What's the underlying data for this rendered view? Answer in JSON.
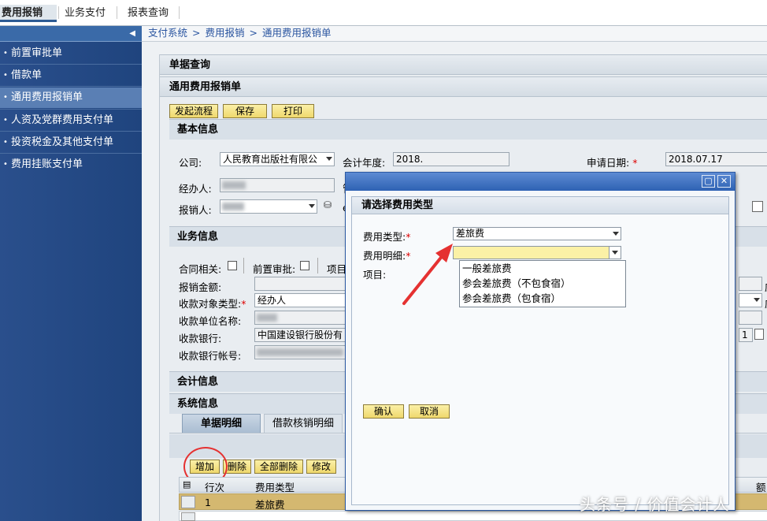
{
  "top_tabs": [
    "费用报销",
    "业务支付",
    "报表查询"
  ],
  "nav": {
    "collapse_icon": "triangle-left-icon",
    "items": [
      "前置审批单",
      "借款单",
      "通用费用报销单",
      "人资及党群费用支付单",
      "投资税金及其他支付单",
      "费用挂账支付单"
    ],
    "bullet": "•"
  },
  "breadcrumb": [
    "支付系统",
    ">",
    "费用报销",
    ">",
    "通用费用报销单"
  ],
  "panels": {
    "query": "单据查询",
    "form_title": "通用费用报销单"
  },
  "toolbar": {
    "submit": "发起流程",
    "save": "保存",
    "print": "打印"
  },
  "basic": {
    "title": "基本信息",
    "company_label": "公司:",
    "company_value": "人民教育出版社有限公",
    "fiscal_year_label": "会计年度:",
    "fiscal_year_value": "2018.",
    "apply_date_label": "申请日期:",
    "apply_date_value": "2018.07.17",
    "handler_label": "经办人:",
    "claimant_label": "报销人:",
    "cut_label_1": "管",
    "cut_label_2": "e"
  },
  "business": {
    "title": "业务信息",
    "contract_label": "合同相关:",
    "preapproval_label": "前置审批:",
    "project_label": "项目",
    "amount_label": "报销金额:",
    "payee_type_label": "收款对象类型:",
    "payee_type_value": "经办人",
    "payee_name_label": "收款单位名称:",
    "bank_label": "收款银行:",
    "bank_value": "中国建设银行股份有",
    "account_label": "收款银行帐号:",
    "cut_text": "应",
    "cut_num": "1"
  },
  "accounting": {
    "title": "会计信息"
  },
  "system": {
    "title": "系统信息"
  },
  "detail_tabs": [
    "单据明细",
    "借款核销明细"
  ],
  "detail_toolbar": {
    "add": "增加",
    "delete": "删除",
    "delete_all": "全部删除",
    "modify": "修改"
  },
  "table": {
    "headers": [
      "行次",
      "费用类型"
    ],
    "rows": [
      {
        "line": "1",
        "type": "差旅费"
      }
    ],
    "cut_header": "额"
  },
  "dialog": {
    "title": "请选择费用类型",
    "maximize_icon": "maximize-icon",
    "close_icon": "close-icon",
    "type_label": "费用类型:",
    "type_value": "差旅费",
    "detail_label": "费用明细:",
    "detail_value": "",
    "project_label": "项目:",
    "options": [
      "一般差旅费",
      "参会差旅费（不包食宿）",
      "参会差旅费（包食宿）"
    ],
    "confirm": "确认",
    "cancel": "取消",
    "required_mark": "*"
  },
  "watermark": "头条号 / 价值会计人",
  "colors": {
    "nav_bg": "#1f447e",
    "accent": "#2d5b93",
    "button": "#efd86c",
    "annotation": "#e53131"
  }
}
